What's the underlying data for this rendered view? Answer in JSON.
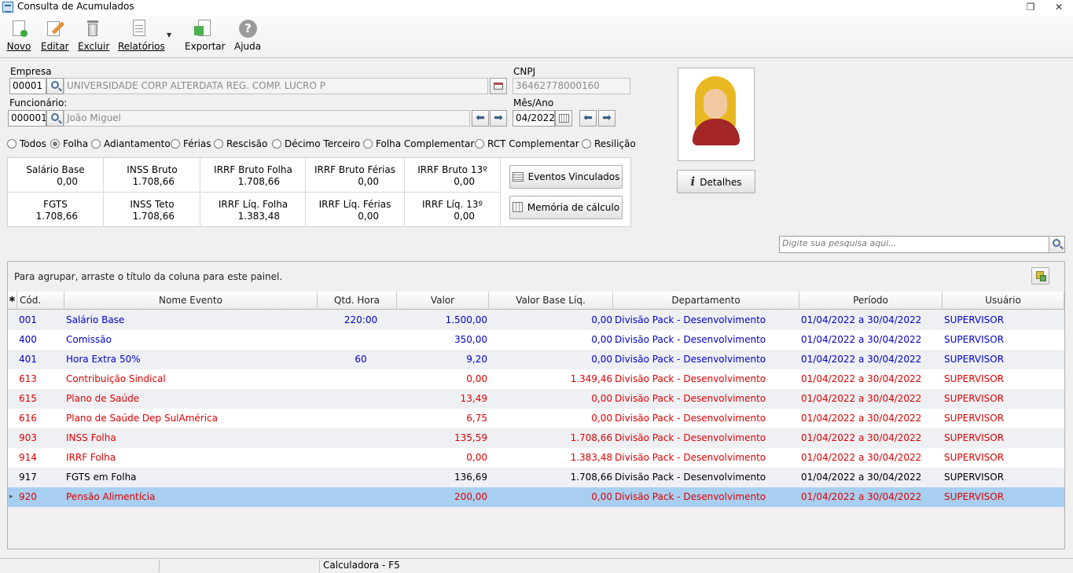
{
  "window": {
    "title": "Consulta de Acumulados"
  },
  "toolbar": {
    "novo": "Novo",
    "editar": "Editar",
    "excluir": "Excluir",
    "relatorios": "Relatórios",
    "exportar": "Exportar",
    "ajuda": "Ajuda"
  },
  "form": {
    "empresa_label": "Empresa",
    "empresa_code": "00001",
    "empresa_name": "UNIVERSIDADE CORP ALTERDATA REG. COMP. LUCRO P",
    "cnpj_label": "CNPJ",
    "cnpj_value": "36462778000160",
    "funcionario_label": "Funcionário:",
    "funcionario_code": "000001",
    "funcionario_name": "João Miguel",
    "mesano_label": "Mês/Ano",
    "mesano_value": "04/2022"
  },
  "radios": [
    {
      "label": "Todos",
      "checked": false
    },
    {
      "label": "Folha",
      "checked": true
    },
    {
      "label": "Adiantamento",
      "checked": false
    },
    {
      "label": "Férias",
      "checked": false
    },
    {
      "label": "Rescisão",
      "checked": false
    },
    {
      "label": "Décimo Terceiro",
      "checked": false
    },
    {
      "label": "Folha Complementar",
      "checked": false
    },
    {
      "label": "RCT Complementar",
      "checked": false
    },
    {
      "label": "Resilição",
      "checked": false
    }
  ],
  "summary": [
    [
      {
        "title": "Salário Base",
        "value": "0,00"
      },
      {
        "title": "INSS Bruto",
        "value": "1.708,66"
      },
      {
        "title": "IRRF Bruto Folha",
        "value": "1.708,66"
      },
      {
        "title": "IRRF Bruto Férias",
        "value": "0,00"
      },
      {
        "title": "IRRF Bruto 13º",
        "value": "0,00"
      }
    ],
    [
      {
        "title": "FGTS",
        "value": "1.708,66"
      },
      {
        "title": "INSS Teto",
        "value": "1.708,66"
      },
      {
        "title": "IRRF Líq. Folha",
        "value": "1.383,48"
      },
      {
        "title": "IRRF Líq. Férias",
        "value": "0,00"
      },
      {
        "title": "IRRF Líq. 13º",
        "value": "0,00"
      }
    ]
  ],
  "buttons": {
    "eventos": "Eventos Vinculados",
    "memoria": "Memória de cálculo",
    "detalhes": "Detalhes"
  },
  "search": {
    "placeholder": "Digite sua pesquisa aqui..."
  },
  "grid": {
    "group_hint": "Para agrupar, arraste o título da coluna para este painel.",
    "columns": [
      "Cód.",
      "Nome Evento",
      "Qtd. Hora",
      "Valor",
      "Valor Base Líq.",
      "Departamento",
      "Período",
      "Usuário"
    ],
    "rows": [
      {
        "cod": "001",
        "nome": "Salário Base",
        "qtd": "220:00",
        "valor": "1.500,00",
        "base": "0,00",
        "depto": "Divisão Pack - Desenvolvimento",
        "periodo": "01/04/2022 a 30/04/2022",
        "usuario": "SUPERVISOR",
        "color": "#0000cc"
      },
      {
        "cod": "400",
        "nome": "Comissão",
        "qtd": "",
        "valor": "350,00",
        "base": "0,00",
        "depto": "Divisão Pack - Desenvolvimento",
        "periodo": "01/04/2022 a 30/04/2022",
        "usuario": "SUPERVISOR",
        "color": "#0000cc"
      },
      {
        "cod": "401",
        "nome": "Hora Extra 50%",
        "qtd": "60",
        "valor": "9,20",
        "base": "0,00",
        "depto": "Divisão Pack - Desenvolvimento",
        "periodo": "01/04/2022 a 30/04/2022",
        "usuario": "SUPERVISOR",
        "color": "#0000cc"
      },
      {
        "cod": "613",
        "nome": "Contribuição Sindical",
        "qtd": "",
        "valor": "0,00",
        "base": "1.349,46",
        "depto": "Divisão Pack - Desenvolvimento",
        "periodo": "01/04/2022 a 30/04/2022",
        "usuario": "SUPERVISOR",
        "color": "#e00000"
      },
      {
        "cod": "615",
        "nome": "Plano de Saúde",
        "qtd": "",
        "valor": "13,49",
        "base": "0,00",
        "depto": "Divisão Pack - Desenvolvimento",
        "periodo": "01/04/2022 a 30/04/2022",
        "usuario": "SUPERVISOR",
        "color": "#e00000"
      },
      {
        "cod": "616",
        "nome": "Plano de Saúde Dep SulAmérica",
        "qtd": "",
        "valor": "6,75",
        "base": "0,00",
        "depto": "Divisão Pack - Desenvolvimento",
        "periodo": "01/04/2022 a 30/04/2022",
        "usuario": "SUPERVISOR",
        "color": "#e00000"
      },
      {
        "cod": "903",
        "nome": "INSS Folha",
        "qtd": "",
        "valor": "135,59",
        "base": "1.708,66",
        "depto": "Divisão Pack - Desenvolvimento",
        "periodo": "01/04/2022 a 30/04/2022",
        "usuario": "SUPERVISOR",
        "color": "#e00000"
      },
      {
        "cod": "914",
        "nome": "IRRF Folha",
        "qtd": "",
        "valor": "0,00",
        "base": "1.383,48",
        "depto": "Divisão Pack - Desenvolvimento",
        "periodo": "01/04/2022 a 30/04/2022",
        "usuario": "SUPERVISOR",
        "color": "#e00000"
      },
      {
        "cod": "917",
        "nome": "FGTS em Folha",
        "qtd": "",
        "valor": "136,69",
        "base": "1.708,66",
        "depto": "Divisão Pack - Desenvolvimento",
        "periodo": "01/04/2022 a 30/04/2022",
        "usuario": "SUPERVISOR",
        "color": "#000000"
      },
      {
        "cod": "920",
        "nome": "Pensão Alimentícia",
        "qtd": "",
        "valor": "200,00",
        "base": "0,00",
        "depto": "Divisão Pack - Desenvolvimento",
        "periodo": "01/04/2022 a 30/04/2022",
        "usuario": "SUPERVISOR",
        "color": "#e00000",
        "selected": true
      }
    ]
  },
  "statusbar": {
    "calc": "Calculadora - F5"
  }
}
